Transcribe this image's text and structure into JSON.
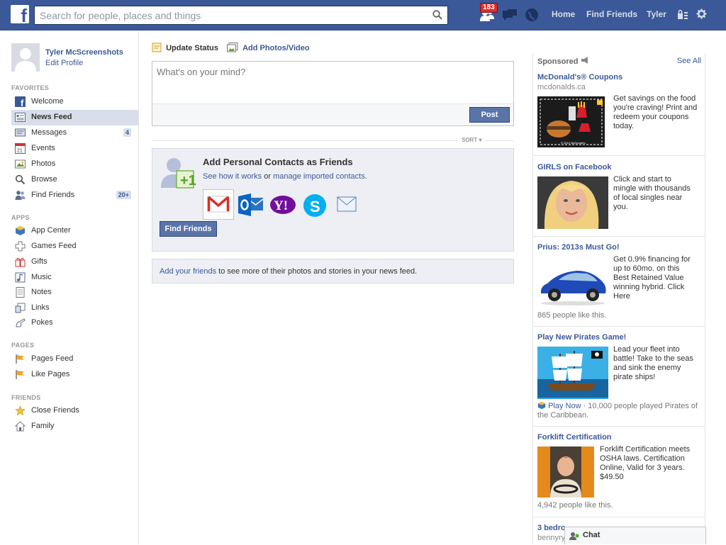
{
  "header": {
    "search_placeholder": "Search for people, places and things",
    "notification_count": "183",
    "nav": [
      "Home",
      "Find Friends",
      "Tyler"
    ]
  },
  "profile": {
    "name": "Tyler McScreenshots",
    "edit": "Edit Profile"
  },
  "sidebar": {
    "sections": {
      "favorites": "FAVORITES",
      "apps": "APPS",
      "pages": "PAGES",
      "friends": "FRIENDS"
    },
    "favorites": [
      {
        "label": "Welcome",
        "icon": "facebook-icon"
      },
      {
        "label": "News Feed",
        "icon": "news-feed-icon",
        "selected": true
      },
      {
        "label": "Messages",
        "icon": "messages-icon",
        "count": "4"
      },
      {
        "label": "Events",
        "icon": "calendar-icon"
      },
      {
        "label": "Photos",
        "icon": "photos-icon"
      },
      {
        "label": "Browse",
        "icon": "search-icon"
      },
      {
        "label": "Find Friends",
        "icon": "find-friends-icon",
        "count": "20+"
      }
    ],
    "apps": [
      {
        "label": "App Center",
        "icon": "app-center-icon"
      },
      {
        "label": "Games Feed",
        "icon": "games-icon"
      },
      {
        "label": "Gifts",
        "icon": "gift-icon"
      },
      {
        "label": "Music",
        "icon": "music-icon"
      },
      {
        "label": "Notes",
        "icon": "notes-icon"
      },
      {
        "label": "Links",
        "icon": "links-icon"
      },
      {
        "label": "Pokes",
        "icon": "poke-icon"
      }
    ],
    "pages": [
      {
        "label": "Pages Feed",
        "icon": "pages-feed-icon"
      },
      {
        "label": "Like Pages",
        "icon": "like-icon"
      }
    ],
    "friends": [
      {
        "label": "Close Friends",
        "icon": "star-icon"
      },
      {
        "label": "Family",
        "icon": "family-icon"
      }
    ]
  },
  "composer": {
    "update_status": "Update Status",
    "add_photos": "Add Photos/Video",
    "placeholder": "What's on your mind?",
    "post": "Post"
  },
  "feed": {
    "sort": "SORT",
    "contacts_title": "Add Personal Contacts as Friends",
    "contacts_link1": "See how it works",
    "contacts_or": "or",
    "contacts_link2": "manage imported contacts",
    "contacts_end": ".",
    "find_friends": "Find Friends",
    "add_friends_link": "Add your friends",
    "add_friends_rest": " to see more of their photos and stories in your news feed."
  },
  "sponsored": {
    "title": "Sponsored",
    "see_all": "See All",
    "ads": [
      {
        "title": "McDonald's® Coupons",
        "domain": "mcdonalds.ca",
        "text": "Get savings on the food you're craving! Print and redeem your coupons today.",
        "image_caption": "© 2012 McDonald's"
      },
      {
        "title": "GIRLS on Facebook",
        "text": "Click and start to mingle with thousands of local singles near you."
      },
      {
        "title": "Prius: 2013s Must Go!",
        "text": "Get 0.9% financing for up to 60mo. on this Best Retained Value winning hybrid. Click Here",
        "likes": "865 people like this."
      },
      {
        "title": "Play New Pirates Game!",
        "text": "Lead your fleet into battle! Take to the seas and sink the enemy pirate ships!",
        "play": "Play Now",
        "played": " · 10,000 people played Pirates of the Caribbean."
      },
      {
        "title": "Forklift Certification",
        "text": "Forklift Certification meets OSHA laws. Certification Online, Valid for 3 years. $49.50",
        "likes": "4,942 people like this."
      },
      {
        "title": "3 bedro",
        "domain": "bennyry"
      }
    ]
  },
  "chat": {
    "label": "Chat"
  }
}
